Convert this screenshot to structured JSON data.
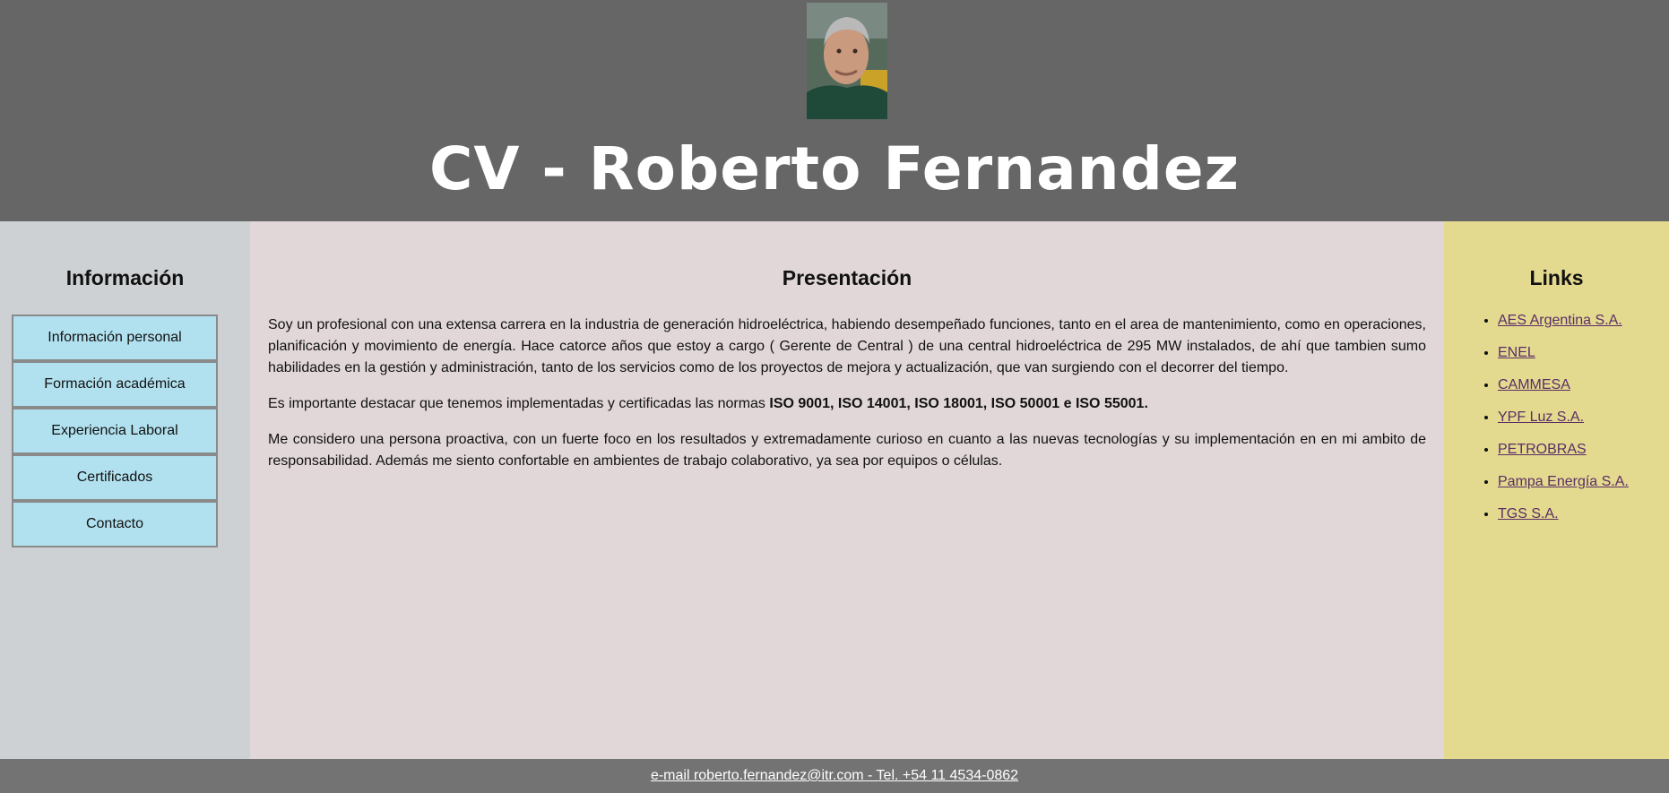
{
  "header": {
    "title": "CV - Roberto Fernandez",
    "photo_icon": "profile-photo"
  },
  "sidebar": {
    "heading": "Información",
    "items": [
      {
        "label": "Información personal"
      },
      {
        "label": "Formación académica"
      },
      {
        "label": "Experiencia Laboral"
      },
      {
        "label": "Certificados"
      },
      {
        "label": "Contacto"
      }
    ]
  },
  "main": {
    "heading": "Presentación",
    "paragraph1": "Soy un profesional con una extensa carrera en la industria de generación hidroeléctrica, habiendo desempeñado funciones, tanto en el area de mantenimiento, como en operaciones, planificación y movimiento de energía. Hace catorce años que estoy a cargo ( Gerente de Central ) de una central hidroeléctrica de 295 MW instalados, de ahí que tambien sumo habilidades en la gestión y administración, tanto de los servicios como de los proyectos de mejora y actualización, que van surgiendo con el decorrer del tiempo.",
    "paragraph2_text": "Es importante destacar que tenemos implementadas y certificadas las normas ",
    "paragraph2_bold": "ISO 9001, ISO 14001, ISO 18001, ISO 50001 e ISO 55001.",
    "paragraph3": "Me considero una persona proactiva, con un fuerte foco en los resultados y extremadamente curioso en cuanto a las nuevas tecnologías y su implementación en en mi ambito de responsabilidad. Además me siento confortable en ambientes de trabajo colaborativo, ya sea por equipos o células."
  },
  "links": {
    "heading": "Links",
    "items": [
      {
        "label": "AES Argentina S.A."
      },
      {
        "label": "ENEL"
      },
      {
        "label": "CAMMESA"
      },
      {
        "label": "YPF Luz S.A."
      },
      {
        "label": "PETROBRAS"
      },
      {
        "label": "Pampa Energía S.A."
      },
      {
        "label": "TGS S.A."
      }
    ]
  },
  "footer": {
    "contact": "e-mail roberto.fernandez@itr.com - Tel. +54 11 4534-0862"
  },
  "colors": {
    "header_bg": "#666666",
    "left_bg": "#cdd1d3",
    "center_bg": "#e1d7d8",
    "right_bg": "#e3da90",
    "button_bg": "#b1e1ef",
    "link_color": "#5b2d64",
    "footer_bg": "#737373"
  }
}
